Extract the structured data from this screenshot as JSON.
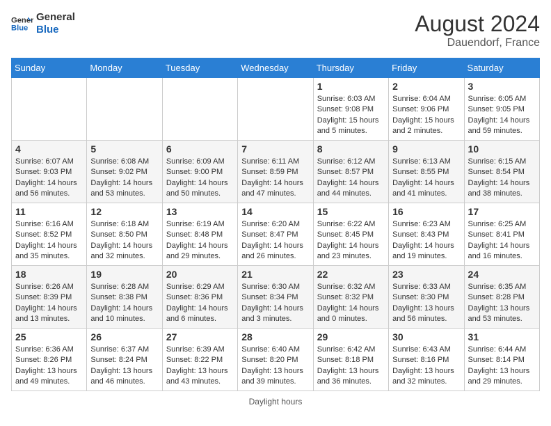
{
  "header": {
    "logo_line1": "General",
    "logo_line2": "Blue",
    "month_year": "August 2024",
    "location": "Dauendorf, France"
  },
  "days_of_week": [
    "Sunday",
    "Monday",
    "Tuesday",
    "Wednesday",
    "Thursday",
    "Friday",
    "Saturday"
  ],
  "weeks": [
    [
      {
        "day": "",
        "info": ""
      },
      {
        "day": "",
        "info": ""
      },
      {
        "day": "",
        "info": ""
      },
      {
        "day": "",
        "info": ""
      },
      {
        "day": "1",
        "info": "Sunrise: 6:03 AM\nSunset: 9:08 PM\nDaylight: 15 hours\nand 5 minutes."
      },
      {
        "day": "2",
        "info": "Sunrise: 6:04 AM\nSunset: 9:06 PM\nDaylight: 15 hours\nand 2 minutes."
      },
      {
        "day": "3",
        "info": "Sunrise: 6:05 AM\nSunset: 9:05 PM\nDaylight: 14 hours\nand 59 minutes."
      }
    ],
    [
      {
        "day": "4",
        "info": "Sunrise: 6:07 AM\nSunset: 9:03 PM\nDaylight: 14 hours\nand 56 minutes."
      },
      {
        "day": "5",
        "info": "Sunrise: 6:08 AM\nSunset: 9:02 PM\nDaylight: 14 hours\nand 53 minutes."
      },
      {
        "day": "6",
        "info": "Sunrise: 6:09 AM\nSunset: 9:00 PM\nDaylight: 14 hours\nand 50 minutes."
      },
      {
        "day": "7",
        "info": "Sunrise: 6:11 AM\nSunset: 8:59 PM\nDaylight: 14 hours\nand 47 minutes."
      },
      {
        "day": "8",
        "info": "Sunrise: 6:12 AM\nSunset: 8:57 PM\nDaylight: 14 hours\nand 44 minutes."
      },
      {
        "day": "9",
        "info": "Sunrise: 6:13 AM\nSunset: 8:55 PM\nDaylight: 14 hours\nand 41 minutes."
      },
      {
        "day": "10",
        "info": "Sunrise: 6:15 AM\nSunset: 8:54 PM\nDaylight: 14 hours\nand 38 minutes."
      }
    ],
    [
      {
        "day": "11",
        "info": "Sunrise: 6:16 AM\nSunset: 8:52 PM\nDaylight: 14 hours\nand 35 minutes."
      },
      {
        "day": "12",
        "info": "Sunrise: 6:18 AM\nSunset: 8:50 PM\nDaylight: 14 hours\nand 32 minutes."
      },
      {
        "day": "13",
        "info": "Sunrise: 6:19 AM\nSunset: 8:48 PM\nDaylight: 14 hours\nand 29 minutes."
      },
      {
        "day": "14",
        "info": "Sunrise: 6:20 AM\nSunset: 8:47 PM\nDaylight: 14 hours\nand 26 minutes."
      },
      {
        "day": "15",
        "info": "Sunrise: 6:22 AM\nSunset: 8:45 PM\nDaylight: 14 hours\nand 23 minutes."
      },
      {
        "day": "16",
        "info": "Sunrise: 6:23 AM\nSunset: 8:43 PM\nDaylight: 14 hours\nand 19 minutes."
      },
      {
        "day": "17",
        "info": "Sunrise: 6:25 AM\nSunset: 8:41 PM\nDaylight: 14 hours\nand 16 minutes."
      }
    ],
    [
      {
        "day": "18",
        "info": "Sunrise: 6:26 AM\nSunset: 8:39 PM\nDaylight: 14 hours\nand 13 minutes."
      },
      {
        "day": "19",
        "info": "Sunrise: 6:28 AM\nSunset: 8:38 PM\nDaylight: 14 hours\nand 10 minutes."
      },
      {
        "day": "20",
        "info": "Sunrise: 6:29 AM\nSunset: 8:36 PM\nDaylight: 14 hours\nand 6 minutes."
      },
      {
        "day": "21",
        "info": "Sunrise: 6:30 AM\nSunset: 8:34 PM\nDaylight: 14 hours\nand 3 minutes."
      },
      {
        "day": "22",
        "info": "Sunrise: 6:32 AM\nSunset: 8:32 PM\nDaylight: 14 hours\nand 0 minutes."
      },
      {
        "day": "23",
        "info": "Sunrise: 6:33 AM\nSunset: 8:30 PM\nDaylight: 13 hours\nand 56 minutes."
      },
      {
        "day": "24",
        "info": "Sunrise: 6:35 AM\nSunset: 8:28 PM\nDaylight: 13 hours\nand 53 minutes."
      }
    ],
    [
      {
        "day": "25",
        "info": "Sunrise: 6:36 AM\nSunset: 8:26 PM\nDaylight: 13 hours\nand 49 minutes."
      },
      {
        "day": "26",
        "info": "Sunrise: 6:37 AM\nSunset: 8:24 PM\nDaylight: 13 hours\nand 46 minutes."
      },
      {
        "day": "27",
        "info": "Sunrise: 6:39 AM\nSunset: 8:22 PM\nDaylight: 13 hours\nand 43 minutes."
      },
      {
        "day": "28",
        "info": "Sunrise: 6:40 AM\nSunset: 8:20 PM\nDaylight: 13 hours\nand 39 minutes."
      },
      {
        "day": "29",
        "info": "Sunrise: 6:42 AM\nSunset: 8:18 PM\nDaylight: 13 hours\nand 36 minutes."
      },
      {
        "day": "30",
        "info": "Sunrise: 6:43 AM\nSunset: 8:16 PM\nDaylight: 13 hours\nand 32 minutes."
      },
      {
        "day": "31",
        "info": "Sunrise: 6:44 AM\nSunset: 8:14 PM\nDaylight: 13 hours\nand 29 minutes."
      }
    ]
  ],
  "footer": {
    "note": "Daylight hours"
  }
}
